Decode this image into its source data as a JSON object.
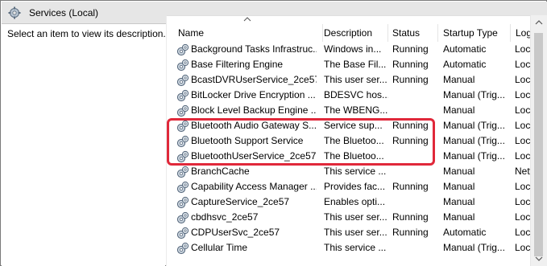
{
  "window": {
    "title": "Services (Local)"
  },
  "description_pane": {
    "text": "Select an item to view its description."
  },
  "columns": {
    "name": "Name",
    "description": "Description",
    "status": "Status",
    "startup_type": "Startup Type",
    "log_on_as": "Log"
  },
  "colors": {
    "highlight": "#e0283a",
    "titlebar": "#e6e6e6"
  },
  "services": [
    {
      "name": "Background Tasks Infrastruc...",
      "description": "Windows in...",
      "status": "Running",
      "startup_type": "Automatic",
      "log_on_as": "Loca"
    },
    {
      "name": "Base Filtering Engine",
      "description": "The Base Fil...",
      "status": "Running",
      "startup_type": "Automatic",
      "log_on_as": "Loca"
    },
    {
      "name": "BcastDVRUserService_2ce57",
      "description": "This user ser...",
      "status": "Running",
      "startup_type": "Manual",
      "log_on_as": "Loca"
    },
    {
      "name": "BitLocker Drive Encryption ...",
      "description": "BDESVC hos...",
      "status": "",
      "startup_type": "Manual (Trig...",
      "log_on_as": "Loca"
    },
    {
      "name": "Block Level Backup Engine ...",
      "description": "The WBENG...",
      "status": "",
      "startup_type": "Manual",
      "log_on_as": "Loca"
    },
    {
      "name": "Bluetooth Audio Gateway S...",
      "description": "Service sup...",
      "status": "Running",
      "startup_type": "Manual (Trig...",
      "log_on_as": "Loca"
    },
    {
      "name": "Bluetooth Support Service",
      "description": "The Bluetoo...",
      "status": "Running",
      "startup_type": "Manual (Trig...",
      "log_on_as": "Loca"
    },
    {
      "name": "BluetoothUserService_2ce57",
      "description": "The Bluetoo...",
      "status": "",
      "startup_type": "Manual (Trig...",
      "log_on_as": "Loca"
    },
    {
      "name": "BranchCache",
      "description": "This service ...",
      "status": "",
      "startup_type": "Manual",
      "log_on_as": "Netw"
    },
    {
      "name": "Capability Access Manager ...",
      "description": "Provides fac...",
      "status": "Running",
      "startup_type": "Manual",
      "log_on_as": "Loca"
    },
    {
      "name": "CaptureService_2ce57",
      "description": "Enables opti...",
      "status": "",
      "startup_type": "Manual",
      "log_on_as": "Loca"
    },
    {
      "name": "cbdhsvc_2ce57",
      "description": "This user ser...",
      "status": "Running",
      "startup_type": "Manual",
      "log_on_as": "Loca"
    },
    {
      "name": "CDPUserSvc_2ce57",
      "description": "This user ser...",
      "status": "Running",
      "startup_type": "Automatic",
      "log_on_as": "Loca"
    },
    {
      "name": "Cellular Time",
      "description": "This service ...",
      "status": "",
      "startup_type": "Manual (Trig...",
      "log_on_as": "Loca"
    }
  ]
}
